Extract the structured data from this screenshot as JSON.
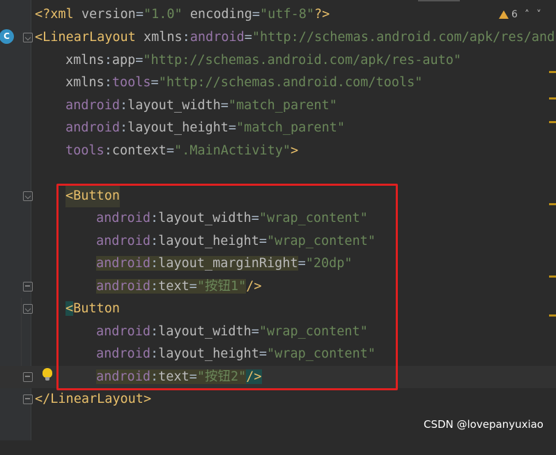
{
  "editor": {
    "inspection": {
      "count": "6",
      "up": "˄",
      "down": "˅"
    },
    "gutter_badge": "C",
    "lines": {
      "l1": {
        "open": "<?",
        "name": "xml",
        "a1": " version",
        "v1": "\"1.0\"",
        "a2": " encoding",
        "v2": "\"utf-8\"",
        "close": "?>"
      },
      "l2": {
        "open": "<",
        "tag": "LinearLayout",
        "sp": " ",
        "ns": "xmlns",
        "colon": ":",
        "attr": "android",
        "eq": "=",
        "val": "\"http://schemas.android.com/apk/res/andr"
      },
      "l3": {
        "ns": "xmlns",
        "colon": ":",
        "attr": "app",
        "eq": "=",
        "val": "\"http://schemas.android.com/apk/res-auto\""
      },
      "l4": {
        "ns": "xmlns",
        "colon": ":",
        "attr": "tools",
        "eq": "=",
        "val": "\"http://schemas.android.com/tools\""
      },
      "l5": {
        "ns": "android",
        "colon": ":",
        "attr": "layout_width",
        "eq": "=",
        "val": "\"match_parent\""
      },
      "l6": {
        "ns": "android",
        "colon": ":",
        "attr": "layout_height",
        "eq": "=",
        "val": "\"match_parent\""
      },
      "l7": {
        "ns": "tools",
        "colon": ":",
        "attr": "context",
        "eq": "=",
        "val": "\".MainActivity\"",
        "close": ">"
      },
      "l9": {
        "open": "<",
        "tag": "Button"
      },
      "l10": {
        "ns": "android",
        "colon": ":",
        "attr": "layout_width",
        "eq": "=",
        "val": "\"wrap_content\""
      },
      "l11": {
        "ns": "android",
        "colon": ":",
        "attr": "layout_height",
        "eq": "=",
        "val": "\"wrap_content\""
      },
      "l12": {
        "ns": "android",
        "colon": ":",
        "attr": "layout_marginRight",
        "eq": "=",
        "val": "\"20dp\""
      },
      "l13": {
        "ns": "android",
        "colon": ":",
        "attr": "text",
        "eq": "=",
        "val": "\"按钮1\"",
        "close": "/>"
      },
      "l14": {
        "open": "<",
        "tag": "Button"
      },
      "l15": {
        "ns": "android",
        "colon": ":",
        "attr": "layout_width",
        "eq": "=",
        "val": "\"wrap_content\""
      },
      "l16": {
        "ns": "android",
        "colon": ":",
        "attr": "layout_height",
        "eq": "=",
        "val": "\"wrap_content\""
      },
      "l17": {
        "ns": "android",
        "colon": ":",
        "attr": "text",
        "eq": "=",
        "val": "\"按钮2\"",
        "close": "/>"
      },
      "l18": {
        "open": "</",
        "tag": "LinearLayout",
        "close": ">"
      }
    }
  },
  "watermark": "CSDN @lovepanyuxiao",
  "colors": {
    "background": "#2b2b2b",
    "tag": "#e8bf6a",
    "namespace": "#9876aa",
    "attribute": "#bababa",
    "value": "#6a8759",
    "highlight_box": "#e02020"
  }
}
